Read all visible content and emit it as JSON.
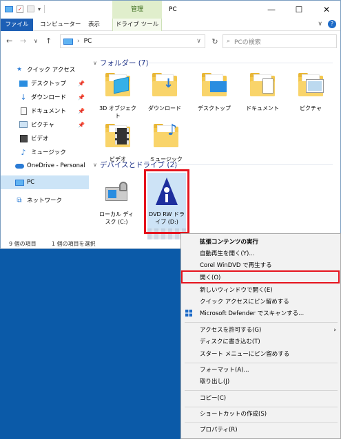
{
  "window": {
    "title": "PC",
    "manage_tab": "管理",
    "controls": [
      "—",
      "☐",
      "✕"
    ]
  },
  "ribbon": {
    "tabs": [
      "ファイル",
      "コンピューター",
      "表示",
      "ドライブ ツール"
    ]
  },
  "address": {
    "path": "PC",
    "search_placeholder": "PCの検索"
  },
  "sidebar": {
    "items": [
      {
        "label": "クイック アクセス",
        "icon": "star-icon"
      },
      {
        "label": "デスクトップ",
        "icon": "desktop-icon",
        "pinned": true
      },
      {
        "label": "ダウンロード",
        "icon": "download-icon",
        "pinned": true
      },
      {
        "label": "ドキュメント",
        "icon": "document-icon",
        "pinned": true
      },
      {
        "label": "ピクチャ",
        "icon": "picture-icon",
        "pinned": true
      },
      {
        "label": "ビデオ",
        "icon": "video-icon"
      },
      {
        "label": "ミュージック",
        "icon": "music-icon"
      },
      {
        "label": "OneDrive - Personal",
        "icon": "cloud-icon"
      },
      {
        "label": "PC",
        "icon": "pc-icon",
        "selected": true
      },
      {
        "label": "ネットワーク",
        "icon": "network-icon"
      }
    ]
  },
  "folders": {
    "header": "フォルダー (7)",
    "items": [
      "3D オブジェクト",
      "ダウンロード",
      "デスクトップ",
      "ドキュメント",
      "ピクチャ",
      "ビデオ",
      "ミュージック"
    ]
  },
  "devices": {
    "header": "デバイスとドライブ (2)",
    "items": [
      "ローカル ディスク (C:)",
      "DVD RW ドライブ (D:)"
    ]
  },
  "status": {
    "count": "9 個の項目",
    "selected": "1 個の項目を選択"
  },
  "context_menu": {
    "items": [
      "拡張コンテンツの実行",
      "自動再生を開く(Y)...",
      "Corel WinDVD で再生する",
      "開く(O)",
      "新しいウィンドウで開く(E)",
      "クイック アクセスにピン留めする",
      "Microsoft Defender でスキャンする...",
      "アクセスを許可する(G)",
      "ディスクに書き込む(T)",
      "スタート メニューにピン留めする",
      "フォーマット(A)...",
      "取り出し(J)",
      "コピー(C)",
      "ショートカットの作成(S)",
      "プロパティ(R)"
    ]
  },
  "colors": {
    "accent": "#1c5fb5",
    "highlight": "#e5131d",
    "desktop": "#0b5aa8"
  }
}
